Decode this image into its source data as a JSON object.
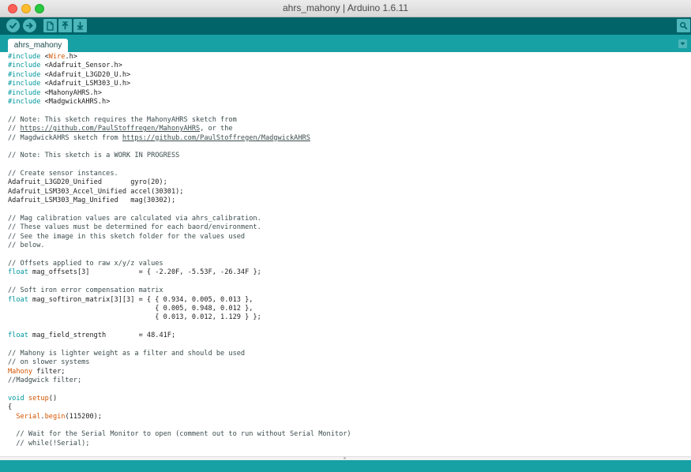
{
  "window": {
    "title": "ahrs_mahony | Arduino 1.6.11"
  },
  "toolbar": {
    "buttons": [
      {
        "name": "verify",
        "icon": "check-icon"
      },
      {
        "name": "upload",
        "icon": "arrow-right-icon"
      },
      {
        "name": "new",
        "icon": "new-file-icon"
      },
      {
        "name": "open",
        "icon": "arrow-up-icon"
      },
      {
        "name": "save",
        "icon": "arrow-down-icon"
      },
      {
        "name": "serial-monitor",
        "icon": "magnifier-icon"
      }
    ]
  },
  "tabs": [
    {
      "label": "ahrs_mahony",
      "active": true
    }
  ],
  "tab_menu_icon": "chevron-down-icon",
  "colors": {
    "toolbar_bg": "#006468",
    "tabbar_bg": "#17a1a5",
    "button_bg": "#4db7bb",
    "keyword": "#00979c",
    "class_name": "#d35400"
  },
  "editor": {
    "lines": [
      "#include <Wire.h>",
      "#include <Adafruit_Sensor.h>",
      "#include <Adafruit_L3GD20_U.h>",
      "#include <Adafruit_LSM303_U.h>",
      "#include <MahonyAHRS.h>",
      "#include <MadgwickAHRS.h>",
      "",
      "// Note: This sketch requires the MahonyAHRS sketch from",
      "// https://github.com/PaulStoffregen/MahonyAHRS, or the",
      "// MagdwickAHRS sketch from https://github.com/PaulStoffregen/MadgwickAHRS",
      "",
      "// Note: This sketch is a WORK IN PROGRESS",
      "",
      "// Create sensor instances.",
      "Adafruit_L3GD20_Unified       gyro(20);",
      "Adafruit_LSM303_Accel_Unified accel(30301);",
      "Adafruit_LSM303_Mag_Unified   mag(30302);",
      "",
      "// Mag calibration values are calculated via ahrs_calibration.",
      "// These values must be determined for each baord/environment.",
      "// See the image in this sketch folder for the values used",
      "// below.",
      "",
      "// Offsets applied to raw x/y/z values",
      "float mag_offsets[3]            = { -2.20F, -5.53F, -26.34F };",
      "",
      "// Soft iron error compensation matrix",
      "float mag_softiron_matrix[3][3] = { { 0.934, 0.005, 0.013 },",
      "                                    { 0.005, 0.948, 0.012 },",
      "                                    { 0.013, 0.012, 1.129 } };",
      "",
      "float mag_field_strength        = 48.41F;",
      "",
      "// Mahony is lighter weight as a filter and should be used",
      "// on slower systems",
      "Mahony filter;",
      "//Madgwick filter;",
      "",
      "void setup()",
      "{",
      "  Serial.begin(115200);",
      "",
      "  // Wait for the Serial Monitor to open (comment out to run without Serial Monitor)",
      "  // while(!Serial);"
    ]
  }
}
